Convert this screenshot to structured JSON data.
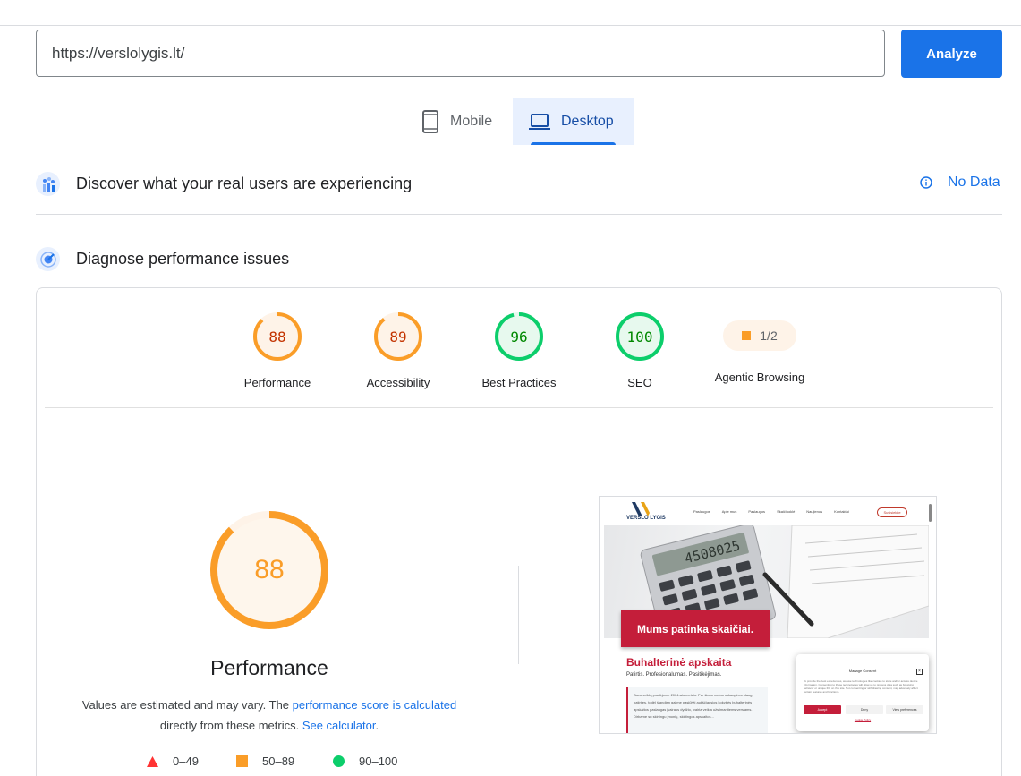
{
  "search": {
    "url_value": "https://verslolygis.lt/",
    "analyze_label": "Analyze"
  },
  "tabs": [
    {
      "label": "Mobile",
      "icon": "phone-icon",
      "selected": false
    },
    {
      "label": "Desktop",
      "icon": "laptop-icon",
      "selected": true
    }
  ],
  "field_data": {
    "title": "Discover what your real users are experiencing",
    "status": "No Data"
  },
  "diagnose": {
    "title": "Diagnose performance issues"
  },
  "categories": [
    {
      "score": "88",
      "label": "Performance",
      "value": 88,
      "color": "#fa9d28",
      "text_color": "#c33300"
    },
    {
      "score": "89",
      "label": "Accessibility",
      "value": 89,
      "color": "#fa9d28",
      "text_color": "#c33300"
    },
    {
      "score": "96",
      "label": "Best Practices",
      "value": 96,
      "color": "#0cce6b",
      "text_color": "#008800"
    },
    {
      "score": "100",
      "label": "SEO",
      "value": 100,
      "color": "#0cce6b",
      "text_color": "#008800"
    }
  ],
  "agentic": {
    "score": "1/2",
    "label": "Agentic Browsing"
  },
  "performance": {
    "score": "88",
    "value": 88,
    "title": "Performance",
    "note_prefix": "Values are estimated and may vary. The ",
    "note_link": "performance score is calculated",
    "note_middle": " directly from these metrics. ",
    "note_link2": "See calculator",
    "note_suffix": "."
  },
  "legend": [
    {
      "range": "0–49",
      "shape": "triangle",
      "color": "#ff3333"
    },
    {
      "range": "50–89",
      "shape": "square",
      "color": "#fa9d28"
    },
    {
      "range": "90–100",
      "shape": "circle",
      "color": "#0cce6b"
    }
  ],
  "screenshot": {
    "logo_text": "VERSLO LYGIS",
    "menu": [
      "Paslaugos",
      "Apie mus",
      "Paslaugos",
      "Skaičiuoklė",
      "Naujienos",
      "Kontaktai"
    ],
    "cta": "Susisiekite",
    "calculator_display": "4508025",
    "banner": "Mums patinka skaičiai.",
    "heading": "Buhalterinė apskaita",
    "subheading": "Patirtis. Profesionalumas. Pasitikėjimas.",
    "body": "Savo veiklą pradėjome 2004-ais metais. Per šiuos metus sukaupėme daug patirties, todėl šiandien galime pasiūlyti aukščiausios kokybės buhalterinės apskaitos paslaugas įvairaus dydžio, įvairia veikla užsiimantiems verslams. Dirbame su skirtingu įmonių, skirtingos apskaitos...",
    "consent_title": "Manage Consent",
    "consent_body": "To provide the best experiences, we use technologies like cookies to store and/or access device information. Consenting to these technologies will allow us to process data such as browsing behavior or unique IDs on this site. Not consenting or withdrawing consent, may adversely affect certain features and functions.",
    "accept": "Accept",
    "deny": "Deny",
    "preferences": "View preferences",
    "cookie_policy": "Cookie Policy"
  }
}
